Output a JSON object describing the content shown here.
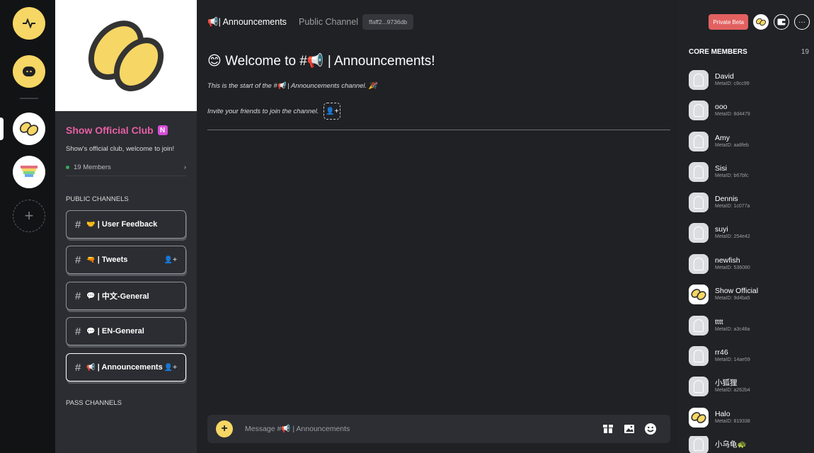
{
  "rail": {
    "add_label": "+"
  },
  "sidebar": {
    "club_name": "Show Official Club",
    "club_badge": "N",
    "club_description": "Show's official club, welcome to join!",
    "members_count": "19 Members",
    "members_chevron": "›",
    "public_channels_title": "PUBLIC CHANNELS",
    "pass_channels_title": "PASS CHANNELS",
    "channels": [
      {
        "hash": "#",
        "emoji": "🤝",
        "label": "| User Feedback"
      },
      {
        "hash": "#",
        "emoji": "🔫",
        "label": "| Tweets",
        "add_user_icon": "👤+"
      },
      {
        "hash": "#",
        "emoji": "💬",
        "label": "| 中文-General"
      },
      {
        "hash": "#",
        "emoji": "💬",
        "label": "| EN-General"
      },
      {
        "hash": "#",
        "emoji": "📢",
        "label": "| Announcements",
        "add_user_icon": "👤+"
      }
    ]
  },
  "header": {
    "channel_title": "📢| Announcements",
    "channel_type": "Public Channel",
    "channel_id": "ffaff2...9736db"
  },
  "chat": {
    "welcome": "😊 Welcome to #📢 | Announcements!",
    "start_line": "This is the start of the #📢 | Announcements channel. 🎉",
    "invite_line": "Invite your friends to join the channel.",
    "invite_icon": "👤+"
  },
  "composer": {
    "plus_label": "+",
    "placeholder": "Message #📢 | Announcements"
  },
  "topright": {
    "beta_label": "Private Beta",
    "more_label": "···"
  },
  "members": {
    "title": "CORE MEMBERS",
    "count": "19",
    "list": [
      {
        "name": "David",
        "metaid": "MetaID: c9cc99"
      },
      {
        "name": "ooo",
        "metaid": "MetaID: 8d4479"
      },
      {
        "name": "Amy",
        "metaid": "MetaID: aa8feb"
      },
      {
        "name": "Sisi",
        "metaid": "MetaID: b67bfc"
      },
      {
        "name": "Dennis",
        "metaid": "MetaID: 1c077a"
      },
      {
        "name": "suyi",
        "metaid": "MetaID: 254e42"
      },
      {
        "name": "newfish",
        "metaid": "MetaID: 536080"
      },
      {
        "name": "Show Official",
        "metaid": "MetaID: 9d4ba5"
      },
      {
        "name": "tttt",
        "metaid": "MetaID: a3c48a"
      },
      {
        "name": "rr46",
        "metaid": "MetaID: 14ae59"
      },
      {
        "name": "小狐狸",
        "metaid": "MetaID: a262b4"
      },
      {
        "name": "Halo",
        "metaid": "MetaID: 819338"
      },
      {
        "name": "小乌龟🐢",
        "metaid": ""
      }
    ]
  },
  "colors": {
    "accent_yellow": "#f6d664",
    "club_pink": "#e85fa4",
    "beta_red": "#e26160"
  }
}
